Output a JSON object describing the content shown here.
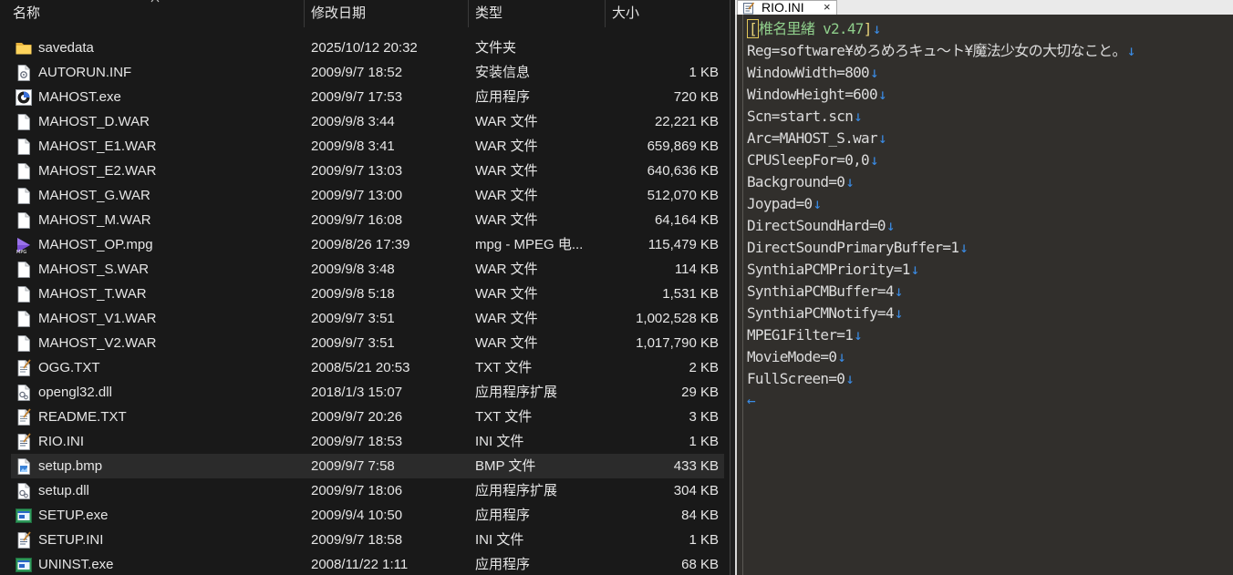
{
  "explorer": {
    "columns": {
      "name": "名称",
      "date": "修改日期",
      "type": "类型",
      "size": "大小"
    },
    "selected_index": 17,
    "files": [
      {
        "icon": "folder-icon",
        "name": "savedata",
        "date": "2025/10/12 20:32",
        "type": "文件夹",
        "size": ""
      },
      {
        "icon": "setup-info-icon",
        "name": "AUTORUN.INF",
        "date": "2009/9/7 18:52",
        "type": "安装信息",
        "size": "1 KB"
      },
      {
        "icon": "app-exe-icon",
        "name": "MAHOST.exe",
        "date": "2009/9/7 17:53",
        "type": "应用程序",
        "size": "720 KB"
      },
      {
        "icon": "file-icon",
        "name": "MAHOST_D.WAR",
        "date": "2009/9/8 3:44",
        "type": "WAR 文件",
        "size": "22,221 KB"
      },
      {
        "icon": "file-icon",
        "name": "MAHOST_E1.WAR",
        "date": "2009/9/8 3:41",
        "type": "WAR 文件",
        "size": "659,869 KB"
      },
      {
        "icon": "file-icon",
        "name": "MAHOST_E2.WAR",
        "date": "2009/9/7 13:03",
        "type": "WAR 文件",
        "size": "640,636 KB"
      },
      {
        "icon": "file-icon",
        "name": "MAHOST_G.WAR",
        "date": "2009/9/7 13:00",
        "type": "WAR 文件",
        "size": "512,070 KB"
      },
      {
        "icon": "file-icon",
        "name": "MAHOST_M.WAR",
        "date": "2009/9/7 16:08",
        "type": "WAR 文件",
        "size": "64,164 KB"
      },
      {
        "icon": "video-icon",
        "name": "MAHOST_OP.mpg",
        "date": "2009/8/26 17:39",
        "type": "mpg - MPEG 电...",
        "size": "115,479 KB"
      },
      {
        "icon": "file-icon",
        "name": "MAHOST_S.WAR",
        "date": "2009/9/8 3:48",
        "type": "WAR 文件",
        "size": "114 KB"
      },
      {
        "icon": "file-icon",
        "name": "MAHOST_T.WAR",
        "date": "2009/9/8 5:18",
        "type": "WAR 文件",
        "size": "1,531 KB"
      },
      {
        "icon": "file-icon",
        "name": "MAHOST_V1.WAR",
        "date": "2009/9/7 3:51",
        "type": "WAR 文件",
        "size": "1,002,528 KB"
      },
      {
        "icon": "file-icon",
        "name": "MAHOST_V2.WAR",
        "date": "2009/9/7 3:51",
        "type": "WAR 文件",
        "size": "1,017,790 KB"
      },
      {
        "icon": "text-file-icon",
        "name": "OGG.TXT",
        "date": "2008/5/21 20:53",
        "type": "TXT 文件",
        "size": "2 KB"
      },
      {
        "icon": "dll-icon",
        "name": "opengl32.dll",
        "date": "2018/1/3 15:07",
        "type": "应用程序扩展",
        "size": "29 KB"
      },
      {
        "icon": "text-file-icon",
        "name": "README.TXT",
        "date": "2009/9/7 20:26",
        "type": "TXT 文件",
        "size": "3 KB"
      },
      {
        "icon": "ini-file-icon",
        "name": "RIO.INI",
        "date": "2009/9/7 18:53",
        "type": "INI 文件",
        "size": "1 KB"
      },
      {
        "icon": "bitmap-icon",
        "name": "setup.bmp",
        "date": "2009/9/7 7:58",
        "type": "BMP 文件",
        "size": "433 KB"
      },
      {
        "icon": "dll-icon",
        "name": "setup.dll",
        "date": "2009/9/7 18:06",
        "type": "应用程序扩展",
        "size": "304 KB"
      },
      {
        "icon": "installer-exe-icon",
        "name": "SETUP.exe",
        "date": "2009/9/4 10:50",
        "type": "应用程序",
        "size": "84 KB"
      },
      {
        "icon": "ini-file-icon",
        "name": "SETUP.INI",
        "date": "2009/9/7 18:58",
        "type": "INI 文件",
        "size": "1 KB"
      },
      {
        "icon": "installer-exe-icon",
        "name": "UNINST.exe",
        "date": "2008/11/22 1:11",
        "type": "应用程序",
        "size": "68 KB"
      }
    ]
  },
  "editor": {
    "tab_title": "RIO.INI",
    "tab_close": "×",
    "section_name": "椎名里緒 v2.47",
    "lines": [
      "Reg=software¥めろめろキュ〜ト¥魔法少女の大切なこと。",
      "WindowWidth=800",
      "WindowHeight=600",
      "Scn=start.scn",
      "Arc=MAHOST_S.war",
      "CPUSleepFor=0,0",
      "Background=0",
      "Joypad=0",
      "DirectSoundHard=0",
      "DirectSoundPrimaryBuffer=1",
      "SynthiaPCMPriority=1",
      "SynthiaPCMBuffer=4",
      "SynthiaPCMNotify=4",
      "MPEG1Filter=1",
      "MovieMode=0",
      "FullScreen=0"
    ],
    "eol_mark": "↓",
    "eof_mark": "←"
  }
}
